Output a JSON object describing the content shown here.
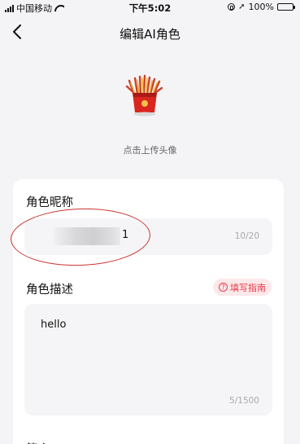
{
  "status_bar": {
    "carrier": "中国移动",
    "time": "下午5:02",
    "battery": "100%",
    "battery_level": 1.0
  },
  "nav": {
    "title": "编辑AI角色",
    "back_icon": "chevron-left-icon"
  },
  "avatar": {
    "hint": "点击上传头像",
    "icon": "fries-box-avatar"
  },
  "form": {
    "nickname": {
      "label": "角色昵称",
      "value_visible_tail": "1",
      "counter": "10/20"
    },
    "description": {
      "label": "角色描述",
      "guide_label": "填写指南",
      "guide_icon": "question-circle-icon",
      "value": "hello",
      "counter": "5/1500"
    },
    "next_section_label": "简介"
  },
  "colors": {
    "accent": "#e8394a",
    "accent_bg": "#fde8ea",
    "annotation": "#c8352f",
    "page_bg": "#f4f4f6"
  }
}
